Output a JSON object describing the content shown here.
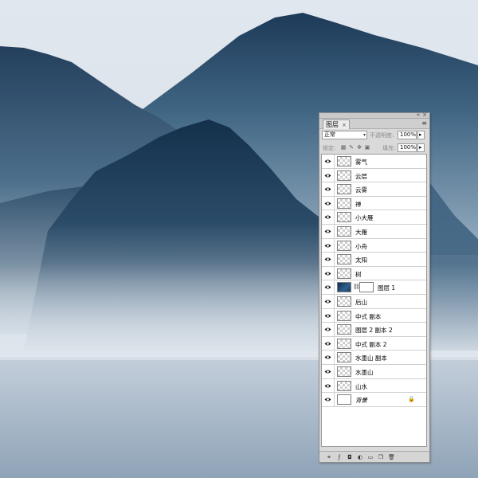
{
  "panel": {
    "tab_label": "图层",
    "tab_close": "×",
    "minimize": "«",
    "close": "×",
    "menu": "≡",
    "blend_mode": "正常",
    "opacity_label": "不透明度:",
    "opacity_value": "100%",
    "lock_label": "锁定:",
    "fill_label": "填充:",
    "fill_value": "100%",
    "dropdown_arrow": "▾",
    "spin_arrow": "▸"
  },
  "layers": [
    {
      "name": "雾气"
    },
    {
      "name": "云层"
    },
    {
      "name": "云雾"
    },
    {
      "name": "禅"
    },
    {
      "name": "小大雁"
    },
    {
      "name": "大雁"
    },
    {
      "name": "小舟"
    },
    {
      "name": "太阳"
    },
    {
      "name": "树"
    },
    {
      "name": "图层 1"
    },
    {
      "name": "后山"
    },
    {
      "name": "中式 副本"
    },
    {
      "name": "图层 2 副本 2"
    },
    {
      "name": "中式 副本 2"
    },
    {
      "name": "水墨山 副本"
    },
    {
      "name": "水墨山"
    },
    {
      "name": "山水"
    },
    {
      "name": "背景"
    }
  ],
  "icons": {
    "eye": "eye-icon",
    "lock_transparent": "lock-transparent-icon",
    "lock_paint": "lock-paint-icon",
    "lock_move": "lock-move-icon",
    "lock_all": "lock-all-icon",
    "footer": [
      "link-layers-icon",
      "fx-icon",
      "add-mask-icon",
      "adjustment-layer-icon",
      "new-group-icon",
      "new-layer-icon",
      "delete-layer-icon"
    ]
  },
  "colors": {
    "sky": "#dde4ec",
    "far_mountain": "#3d6480",
    "near_mountain": "#1c3850",
    "water": "#a9b8c8"
  }
}
